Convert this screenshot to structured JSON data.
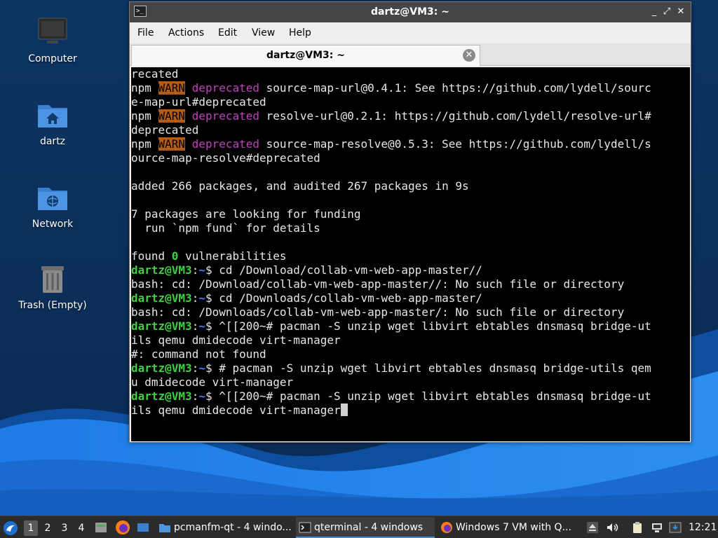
{
  "desktop": {
    "icons": [
      {
        "label": "Computer"
      },
      {
        "label": "dartz"
      },
      {
        "label": "Network"
      },
      {
        "label": "Trash (Empty)"
      }
    ]
  },
  "window": {
    "title": "dartz@VM3: ~",
    "controls": {
      "minimize": "_",
      "maximize": "⤢",
      "close": "✕"
    },
    "menu": [
      "File",
      "Actions",
      "Edit",
      "View",
      "Help"
    ],
    "tab_label": "dartz@VM3: ~",
    "tab_close": "✕"
  },
  "terminal": {
    "lines": [
      [
        {
          "t": "recated"
        }
      ],
      [
        {
          "t": "npm "
        },
        {
          "t": "WARN",
          "c": "warn"
        },
        {
          "t": " "
        },
        {
          "t": "deprecated",
          "c": "depr"
        },
        {
          "t": " source-map-url@0.4.1: See https://github.com/lydell/sourc"
        }
      ],
      [
        {
          "t": "e-map-url#deprecated"
        }
      ],
      [
        {
          "t": "npm "
        },
        {
          "t": "WARN",
          "c": "warn"
        },
        {
          "t": " "
        },
        {
          "t": "deprecated",
          "c": "depr"
        },
        {
          "t": " resolve-url@0.2.1: https://github.com/lydell/resolve-url#"
        }
      ],
      [
        {
          "t": "deprecated"
        }
      ],
      [
        {
          "t": "npm "
        },
        {
          "t": "WARN",
          "c": "warn"
        },
        {
          "t": " "
        },
        {
          "t": "deprecated",
          "c": "depr"
        },
        {
          "t": " source-map-resolve@0.5.3: See https://github.com/lydell/s"
        }
      ],
      [
        {
          "t": "ource-map-resolve#deprecated"
        }
      ],
      [
        {
          "t": ""
        }
      ],
      [
        {
          "t": "added 266 packages, and audited 267 packages in 9s"
        }
      ],
      [
        {
          "t": ""
        }
      ],
      [
        {
          "t": "7 packages are looking for funding"
        }
      ],
      [
        {
          "t": "  run `npm fund` for details"
        }
      ],
      [
        {
          "t": ""
        }
      ],
      [
        {
          "t": "found "
        },
        {
          "t": "0",
          "c": "num0"
        },
        {
          "t": " vulnerabilities"
        }
      ],
      [
        {
          "t": "dartz@VM3",
          "c": "user"
        },
        {
          "t": ":"
        },
        {
          "t": "~",
          "c": "path"
        },
        {
          "t": "$ cd /Download/collab-vm-web-app-master//"
        }
      ],
      [
        {
          "t": "bash: cd: /Download/collab-vm-web-app-master//: No such file or directory"
        }
      ],
      [
        {
          "t": "dartz@VM3",
          "c": "user"
        },
        {
          "t": ":"
        },
        {
          "t": "~",
          "c": "path"
        },
        {
          "t": "$ cd /Downloads/collab-vm-web-app-master/"
        }
      ],
      [
        {
          "t": "bash: cd: /Downloads/collab-vm-web-app-master/: No such file or directory"
        }
      ],
      [
        {
          "t": "dartz@VM3",
          "c": "user"
        },
        {
          "t": ":"
        },
        {
          "t": "~",
          "c": "path"
        },
        {
          "t": "$ ^[[200~# pacman -S unzip wget libvirt ebtables dnsmasq bridge-ut"
        }
      ],
      [
        {
          "t": "ils qemu dmidecode virt-manager"
        }
      ],
      [
        {
          "t": "#: command not found"
        }
      ],
      [
        {
          "t": "dartz@VM3",
          "c": "user"
        },
        {
          "t": ":"
        },
        {
          "t": "~",
          "c": "path"
        },
        {
          "t": "$ # pacman -S unzip wget libvirt ebtables dnsmasq bridge-utils qem"
        }
      ],
      [
        {
          "t": "u dmidecode virt-manager"
        }
      ],
      [
        {
          "t": "dartz@VM3",
          "c": "user"
        },
        {
          "t": ":"
        },
        {
          "t": "~",
          "c": "path"
        },
        {
          "t": "$ ^[[200~# pacman -S unzip wget libvirt ebtables dnsmasq bridge-ut"
        }
      ],
      [
        {
          "t": "ils qemu dmidecode virt-manager"
        },
        {
          "t": "",
          "c": "cursor"
        }
      ]
    ]
  },
  "taskbar": {
    "workspaces": [
      "1",
      "2",
      "3",
      "4"
    ],
    "active_workspace": "1",
    "tasks": [
      {
        "label": "pcmanfm-qt - 4 windo..."
      },
      {
        "label": "qterminal - 4 windows"
      },
      {
        "label": "Windows 7 VM with Q..."
      }
    ],
    "clock": "12:21"
  },
  "colors": {
    "warn_bg": "#b55c12",
    "deprecated": "#c23ec2",
    "prompt_user": "#3fcf3f",
    "prompt_path": "#4a78ff"
  }
}
